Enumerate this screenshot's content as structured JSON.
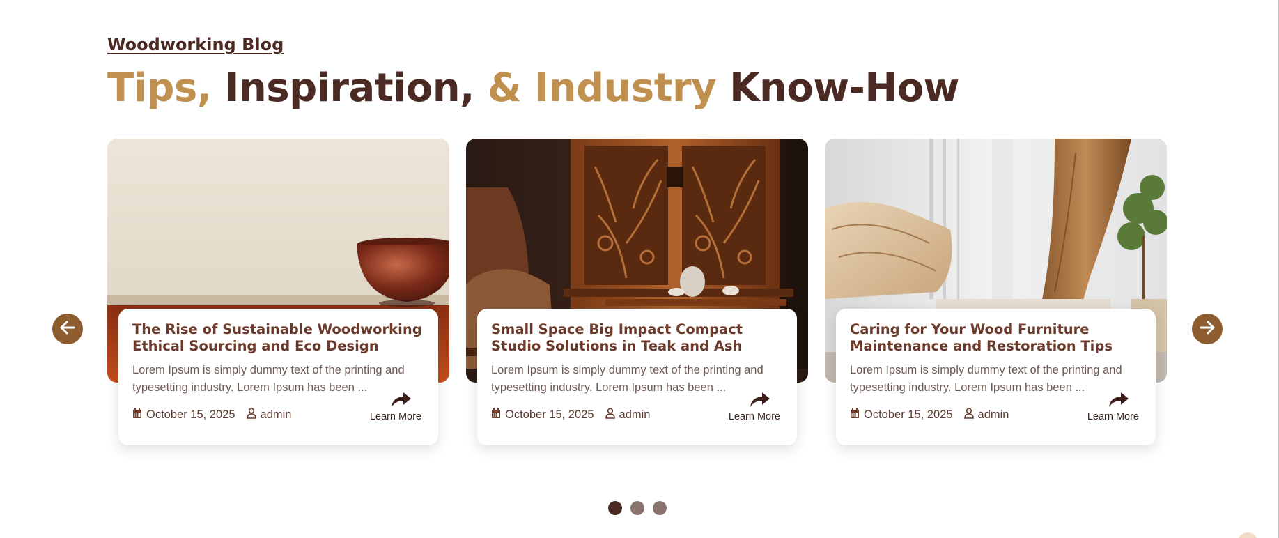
{
  "section": {
    "eyebrow": "Woodworking Blog",
    "headline": {
      "part1": "Tips,",
      "part2": "Inspiration,",
      "part3": "& Industry",
      "part4": "Know-How"
    }
  },
  "colors": {
    "accent_gold": "#c0904f",
    "dark_brown": "#4a2a22",
    "nav_button": "#8d5c2f",
    "dot_active": "#4a2a22",
    "dot_inactive": "#8a7470"
  },
  "posts": [
    {
      "title": "The Rise of Sustainable Woodworking Ethical Sourcing and Eco Design",
      "excerpt": "Lorem Ipsum is simply dummy text of the printing and typesetting industry. Lorem Ipsum has been ...",
      "date": "October 15, 2025",
      "author": "admin",
      "cta": "Learn More",
      "image": "wooden-bowl-on-table"
    },
    {
      "title": "Small Space Big Impact Compact Studio Solutions in Teak and Ash",
      "excerpt": "Lorem Ipsum is simply dummy text of the printing and typesetting industry. Lorem Ipsum has been ...",
      "date": "October 15, 2025",
      "author": "admin",
      "cta": "Learn More",
      "image": "carved-cabinet-and-tea-set"
    },
    {
      "title": "Caring for Your Wood Furniture Maintenance and Restoration Tips",
      "excerpt": "Lorem Ipsum is simply dummy text of the printing and typesetting industry. Lorem Ipsum has been ...",
      "date": "October 15, 2025",
      "author": "admin",
      "cta": "Learn More",
      "image": "live-edge-wood-slabs"
    }
  ],
  "carousel": {
    "prev_icon": "arrow-left-icon",
    "next_icon": "arrow-right-icon",
    "pages": 3,
    "active_page": 1
  }
}
